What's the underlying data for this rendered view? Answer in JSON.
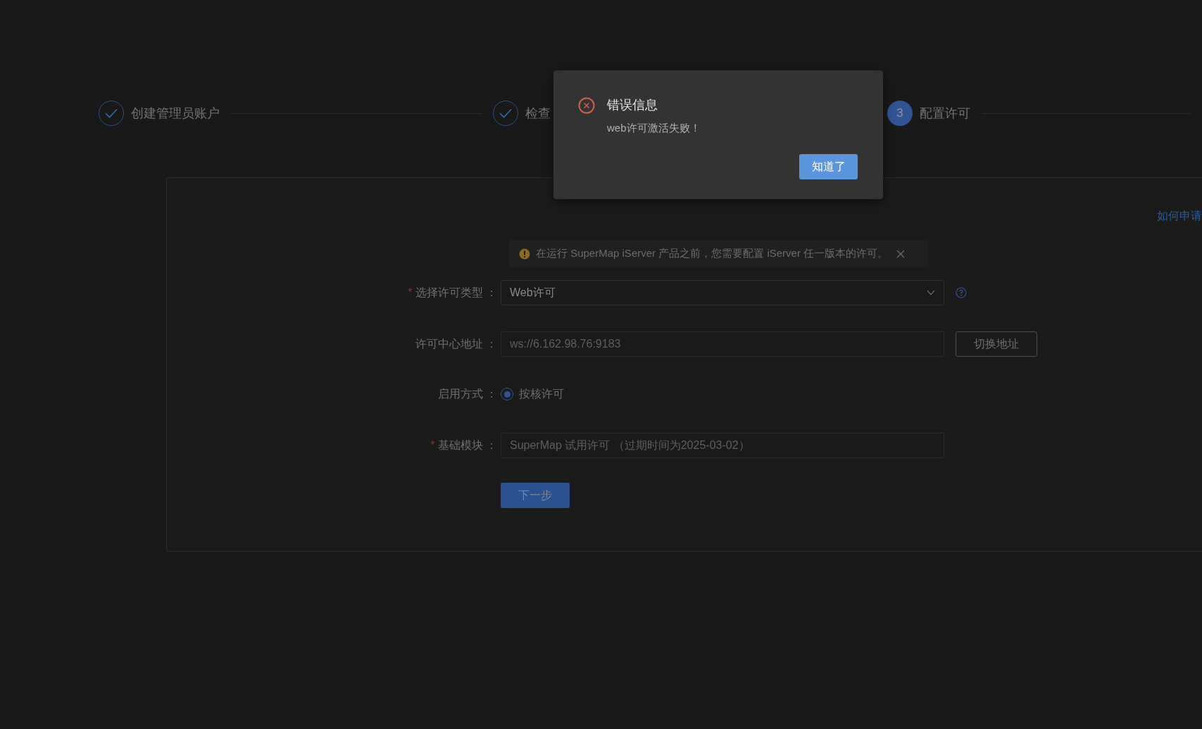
{
  "steps": [
    {
      "label": "创建管理员账户",
      "kind": "done"
    },
    {
      "label": "检查",
      "kind": "done"
    },
    {
      "label": "配置许可",
      "number": "3",
      "kind": "current"
    }
  ],
  "help_link": "如何申请",
  "alert": {
    "text": "在运行 SuperMap iServer 产品之前，您需要配置 iServer 任一版本的许可。",
    "closable": true
  },
  "form": {
    "fields": [
      {
        "kind": "select",
        "label": "选择许可类型 ：",
        "required_mark": "*",
        "value": "Web许可",
        "help": true
      },
      {
        "kind": "input",
        "label": "许可中心地址 ：",
        "placeholder": "ws://6.162.98.76:9183",
        "button": "切换地址"
      },
      {
        "kind": "radio",
        "label": "启用方式 ：",
        "options": [
          {
            "label": "按核许可",
            "selected": true
          }
        ]
      },
      {
        "kind": "input",
        "label": "基础模块 ：",
        "required_mark": "*",
        "placeholder": "SuperMap 试用许可 （过期时间为2025-03-02）"
      }
    ],
    "submit": "下一步"
  },
  "dialog": {
    "kind": "error",
    "title": "错误信息",
    "message": "web许可激活失败！",
    "button": "知道了"
  }
}
